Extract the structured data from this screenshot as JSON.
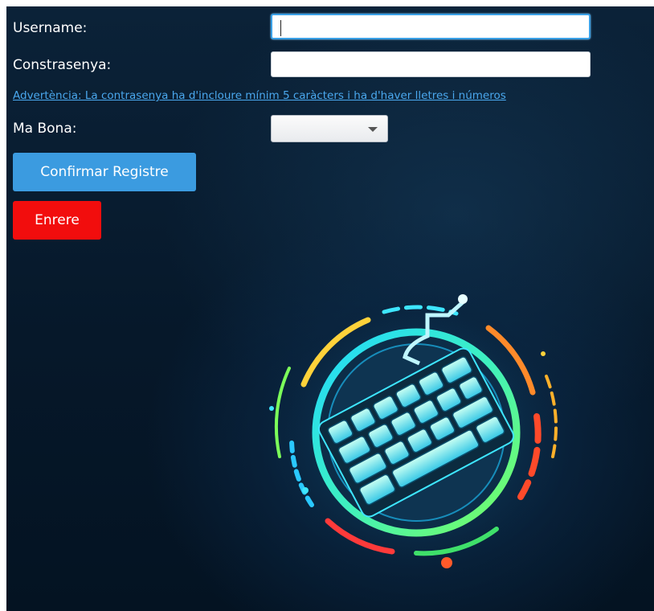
{
  "form": {
    "username_label": "Username:",
    "username_value": "",
    "password_label": "Constrasenya:",
    "password_value": "",
    "warning_text": "Advertència: La contrasenya ha d'incloure mínim 5 caràcters i ha d'haver lletres i números",
    "hand_label": "Ma Bona:",
    "hand_selected": ""
  },
  "buttons": {
    "confirm_label": "Confirmar Registre",
    "back_label": "Enrere"
  },
  "colors": {
    "confirm_button": "#3b9be0",
    "back_button": "#f20d0d",
    "warning_link": "#4aa8ee",
    "background": "#06182a"
  },
  "icons": {
    "logo": "keyboard-logo-icon",
    "dropdown": "chevron-down-icon"
  }
}
